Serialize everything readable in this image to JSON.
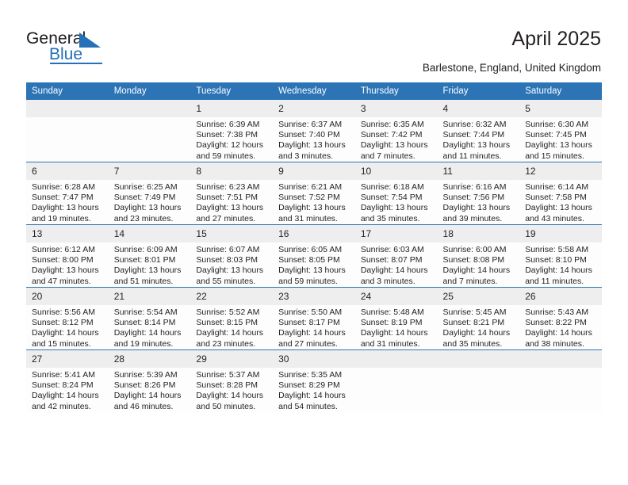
{
  "brand": {
    "name_part1": "General",
    "name_part2": "Blue",
    "triangle_color": "#2570b8"
  },
  "header": {
    "title": "April 2025",
    "subtitle": "Barlestone, England, United Kingdom"
  },
  "theme": {
    "header_blue": "#2c74b6",
    "daynum_gray": "#eeeeee",
    "text": "#231f20"
  },
  "calendar": {
    "weekday_headers": [
      "Sunday",
      "Monday",
      "Tuesday",
      "Wednesday",
      "Thursday",
      "Friday",
      "Saturday"
    ],
    "labels": {
      "sunrise": "Sunrise:",
      "sunset": "Sunset:",
      "daylight": "Daylight:"
    },
    "weeks": [
      [
        {
          "empty": true,
          "day": ""
        },
        {
          "empty": true,
          "day": ""
        },
        {
          "day": "1",
          "sunrise": "Sunrise: 6:39 AM",
          "sunset": "Sunset: 7:38 PM",
          "daylight_l1": "Daylight: 12 hours",
          "daylight_l2": "and 59 minutes."
        },
        {
          "day": "2",
          "sunrise": "Sunrise: 6:37 AM",
          "sunset": "Sunset: 7:40 PM",
          "daylight_l1": "Daylight: 13 hours",
          "daylight_l2": "and 3 minutes."
        },
        {
          "day": "3",
          "sunrise": "Sunrise: 6:35 AM",
          "sunset": "Sunset: 7:42 PM",
          "daylight_l1": "Daylight: 13 hours",
          "daylight_l2": "and 7 minutes."
        },
        {
          "day": "4",
          "sunrise": "Sunrise: 6:32 AM",
          "sunset": "Sunset: 7:44 PM",
          "daylight_l1": "Daylight: 13 hours",
          "daylight_l2": "and 11 minutes."
        },
        {
          "day": "5",
          "sunrise": "Sunrise: 6:30 AM",
          "sunset": "Sunset: 7:45 PM",
          "daylight_l1": "Daylight: 13 hours",
          "daylight_l2": "and 15 minutes."
        }
      ],
      [
        {
          "day": "6",
          "sunrise": "Sunrise: 6:28 AM",
          "sunset": "Sunset: 7:47 PM",
          "daylight_l1": "Daylight: 13 hours",
          "daylight_l2": "and 19 minutes."
        },
        {
          "day": "7",
          "sunrise": "Sunrise: 6:25 AM",
          "sunset": "Sunset: 7:49 PM",
          "daylight_l1": "Daylight: 13 hours",
          "daylight_l2": "and 23 minutes."
        },
        {
          "day": "8",
          "sunrise": "Sunrise: 6:23 AM",
          "sunset": "Sunset: 7:51 PM",
          "daylight_l1": "Daylight: 13 hours",
          "daylight_l2": "and 27 minutes."
        },
        {
          "day": "9",
          "sunrise": "Sunrise: 6:21 AM",
          "sunset": "Sunset: 7:52 PM",
          "daylight_l1": "Daylight: 13 hours",
          "daylight_l2": "and 31 minutes."
        },
        {
          "day": "10",
          "sunrise": "Sunrise: 6:18 AM",
          "sunset": "Sunset: 7:54 PM",
          "daylight_l1": "Daylight: 13 hours",
          "daylight_l2": "and 35 minutes."
        },
        {
          "day": "11",
          "sunrise": "Sunrise: 6:16 AM",
          "sunset": "Sunset: 7:56 PM",
          "daylight_l1": "Daylight: 13 hours",
          "daylight_l2": "and 39 minutes."
        },
        {
          "day": "12",
          "sunrise": "Sunrise: 6:14 AM",
          "sunset": "Sunset: 7:58 PM",
          "daylight_l1": "Daylight: 13 hours",
          "daylight_l2": "and 43 minutes."
        }
      ],
      [
        {
          "day": "13",
          "sunrise": "Sunrise: 6:12 AM",
          "sunset": "Sunset: 8:00 PM",
          "daylight_l1": "Daylight: 13 hours",
          "daylight_l2": "and 47 minutes."
        },
        {
          "day": "14",
          "sunrise": "Sunrise: 6:09 AM",
          "sunset": "Sunset: 8:01 PM",
          "daylight_l1": "Daylight: 13 hours",
          "daylight_l2": "and 51 minutes."
        },
        {
          "day": "15",
          "sunrise": "Sunrise: 6:07 AM",
          "sunset": "Sunset: 8:03 PM",
          "daylight_l1": "Daylight: 13 hours",
          "daylight_l2": "and 55 minutes."
        },
        {
          "day": "16",
          "sunrise": "Sunrise: 6:05 AM",
          "sunset": "Sunset: 8:05 PM",
          "daylight_l1": "Daylight: 13 hours",
          "daylight_l2": "and 59 minutes."
        },
        {
          "day": "17",
          "sunrise": "Sunrise: 6:03 AM",
          "sunset": "Sunset: 8:07 PM",
          "daylight_l1": "Daylight: 14 hours",
          "daylight_l2": "and 3 minutes."
        },
        {
          "day": "18",
          "sunrise": "Sunrise: 6:00 AM",
          "sunset": "Sunset: 8:08 PM",
          "daylight_l1": "Daylight: 14 hours",
          "daylight_l2": "and 7 minutes."
        },
        {
          "day": "19",
          "sunrise": "Sunrise: 5:58 AM",
          "sunset": "Sunset: 8:10 PM",
          "daylight_l1": "Daylight: 14 hours",
          "daylight_l2": "and 11 minutes."
        }
      ],
      [
        {
          "day": "20",
          "sunrise": "Sunrise: 5:56 AM",
          "sunset": "Sunset: 8:12 PM",
          "daylight_l1": "Daylight: 14 hours",
          "daylight_l2": "and 15 minutes."
        },
        {
          "day": "21",
          "sunrise": "Sunrise: 5:54 AM",
          "sunset": "Sunset: 8:14 PM",
          "daylight_l1": "Daylight: 14 hours",
          "daylight_l2": "and 19 minutes."
        },
        {
          "day": "22",
          "sunrise": "Sunrise: 5:52 AM",
          "sunset": "Sunset: 8:15 PM",
          "daylight_l1": "Daylight: 14 hours",
          "daylight_l2": "and 23 minutes."
        },
        {
          "day": "23",
          "sunrise": "Sunrise: 5:50 AM",
          "sunset": "Sunset: 8:17 PM",
          "daylight_l1": "Daylight: 14 hours",
          "daylight_l2": "and 27 minutes."
        },
        {
          "day": "24",
          "sunrise": "Sunrise: 5:48 AM",
          "sunset": "Sunset: 8:19 PM",
          "daylight_l1": "Daylight: 14 hours",
          "daylight_l2": "and 31 minutes."
        },
        {
          "day": "25",
          "sunrise": "Sunrise: 5:45 AM",
          "sunset": "Sunset: 8:21 PM",
          "daylight_l1": "Daylight: 14 hours",
          "daylight_l2": "and 35 minutes."
        },
        {
          "day": "26",
          "sunrise": "Sunrise: 5:43 AM",
          "sunset": "Sunset: 8:22 PM",
          "daylight_l1": "Daylight: 14 hours",
          "daylight_l2": "and 38 minutes."
        }
      ],
      [
        {
          "day": "27",
          "sunrise": "Sunrise: 5:41 AM",
          "sunset": "Sunset: 8:24 PM",
          "daylight_l1": "Daylight: 14 hours",
          "daylight_l2": "and 42 minutes."
        },
        {
          "day": "28",
          "sunrise": "Sunrise: 5:39 AM",
          "sunset": "Sunset: 8:26 PM",
          "daylight_l1": "Daylight: 14 hours",
          "daylight_l2": "and 46 minutes."
        },
        {
          "day": "29",
          "sunrise": "Sunrise: 5:37 AM",
          "sunset": "Sunset: 8:28 PM",
          "daylight_l1": "Daylight: 14 hours",
          "daylight_l2": "and 50 minutes."
        },
        {
          "day": "30",
          "sunrise": "Sunrise: 5:35 AM",
          "sunset": "Sunset: 8:29 PM",
          "daylight_l1": "Daylight: 14 hours",
          "daylight_l2": "and 54 minutes."
        },
        {
          "empty": true,
          "day": ""
        },
        {
          "empty": true,
          "day": ""
        },
        {
          "empty": true,
          "day": ""
        }
      ]
    ]
  }
}
